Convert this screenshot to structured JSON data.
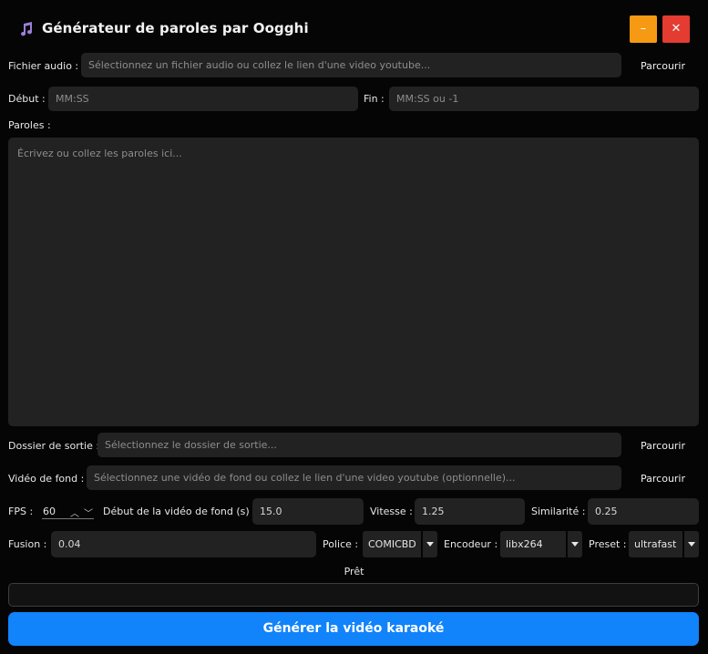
{
  "window": {
    "title": "Générateur de paroles par Oogghi",
    "app_icon": "music-note-icon",
    "minimize_label": "–",
    "close_label": "✕"
  },
  "audio": {
    "label": "Fichier audio :",
    "placeholder": "Sélectionnez un fichier audio ou collez le lien d'une video youtube...",
    "browse": "Parcourir"
  },
  "timing": {
    "start_label": "Début :",
    "start_placeholder": "MM:SS",
    "end_label": "Fin :",
    "end_placeholder": "MM:SS ou -1"
  },
  "lyrics": {
    "label": "Paroles :",
    "placeholder": "Écrivez ou collez les paroles ici..."
  },
  "output": {
    "label": "Dossier de sortie :",
    "placeholder": "Sélectionnez le dossier de sortie...",
    "browse": "Parcourir"
  },
  "background": {
    "label": "Vidéo de fond :",
    "placeholder": "Sélectionnez une vidéo de fond ou collez le lien d'une video youtube (optionnelle)...",
    "browse": "Parcourir"
  },
  "params": {
    "fps_label": "FPS :",
    "fps_value": "60",
    "fps_up": "︿",
    "fps_down": "﹀",
    "bg_start_label": "Début de la vidéo de fond (s) :",
    "bg_start_value": "15.0",
    "speed_label": "Vitesse :",
    "speed_value": "1.25",
    "similarity_label": "Similarité :",
    "similarity_value": "0.25",
    "fusion_label": "Fusion :",
    "fusion_value": "0.04",
    "font_label": "Police :",
    "font_value": "COMICBD",
    "encoder_label": "Encodeur :",
    "encoder_value": "libx264",
    "preset_label": "Preset :",
    "preset_value": "ultrafast"
  },
  "status": {
    "text": "Prêt",
    "progress": 0
  },
  "generate_button": "Générer la vidéo karaoké",
  "colors": {
    "accent": "#1183fb",
    "minimize": "#f59a12",
    "close": "#e43c31",
    "background": "#050505",
    "field": "#222222"
  }
}
